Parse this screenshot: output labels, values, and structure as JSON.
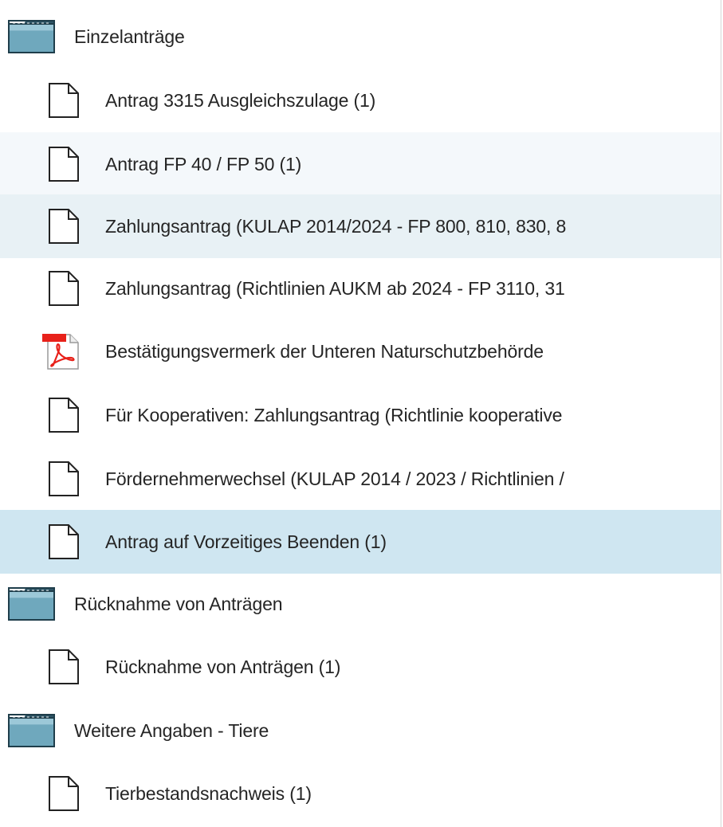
{
  "tree": {
    "groups": [
      {
        "label": "Einzelanträge",
        "icon": "folder-icon",
        "items": [
          {
            "label": "Antrag 3315 Ausgleichszulage (1)",
            "icon": "document-icon"
          },
          {
            "label": "Antrag FP 40 / FP 50 (1)",
            "icon": "document-icon"
          },
          {
            "label": "Zahlungsantrag (KULAP 2014/2024 - FP 800, 810, 830, 8",
            "icon": "document-icon"
          },
          {
            "label": "Zahlungsantrag (Richtlinien AUKM ab 2024 - FP 3110, 31",
            "icon": "document-icon"
          },
          {
            "label": "Bestätigungsvermerk der Unteren Naturschutzbehörde",
            "icon": "pdf-icon"
          },
          {
            "label": "Für Kooperativen: Zahlungsantrag (Richtlinie kooperative",
            "icon": "document-icon"
          },
          {
            "label": "Fördernehmerwechsel (KULAP 2014 / 2023 / Richtlinien /",
            "icon": "document-icon"
          },
          {
            "label": "Antrag auf Vorzeitiges Beenden (1)",
            "icon": "document-icon",
            "selected": true
          }
        ]
      },
      {
        "label": "Rücknahme von Anträgen",
        "icon": "folder-icon",
        "items": [
          {
            "label": "Rücknahme von Anträgen (1)",
            "icon": "document-icon"
          }
        ]
      },
      {
        "label": "Weitere Angaben - Tiere",
        "icon": "folder-icon",
        "items": [
          {
            "label": "Tierbestandsnachweis (1)",
            "icon": "document-icon"
          }
        ]
      }
    ]
  },
  "colors": {
    "hover_row": "#f4f8fb",
    "alt_row": "#e8f1f5",
    "selected_row": "#cfe6f1",
    "folder": "#7fb3c6",
    "pdf_red": "#e8211a"
  }
}
